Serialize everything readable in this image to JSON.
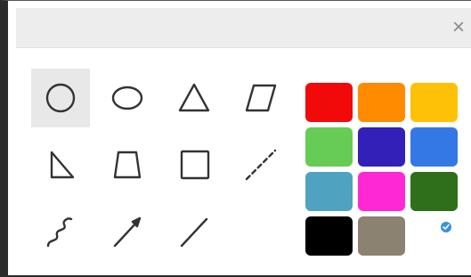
{
  "dialog": {
    "close_glyph": "×"
  },
  "tools": [
    {
      "name": "circle",
      "icon": "circle-icon",
      "selected": true
    },
    {
      "name": "ellipse",
      "icon": "ellipse-icon",
      "selected": false
    },
    {
      "name": "triangle",
      "icon": "triangle-icon",
      "selected": false
    },
    {
      "name": "parallelogram",
      "icon": "parallelogram-icon",
      "selected": false
    },
    {
      "name": "right-triangle",
      "icon": "right-triangle-icon",
      "selected": false
    },
    {
      "name": "trapezoid",
      "icon": "trapezoid-icon",
      "selected": false
    },
    {
      "name": "square",
      "icon": "square-icon",
      "selected": false
    },
    {
      "name": "dashed-line",
      "icon": "dashed-line-icon",
      "selected": false
    },
    {
      "name": "freehand",
      "icon": "freehand-wave-icon",
      "selected": false
    },
    {
      "name": "arrow",
      "icon": "arrow-icon",
      "selected": false
    },
    {
      "name": "line",
      "icon": "line-icon",
      "selected": false
    }
  ],
  "palette": {
    "colors": [
      "#f20a0a",
      "#ff8c00",
      "#ffc107",
      "#66cc55",
      "#3320b8",
      "#3478e6",
      "#4fa3c0",
      "#ff28d4",
      "#2f6e1a",
      "#000000",
      "#8c8272"
    ],
    "selected_indicator_color": "#3a8fde"
  }
}
